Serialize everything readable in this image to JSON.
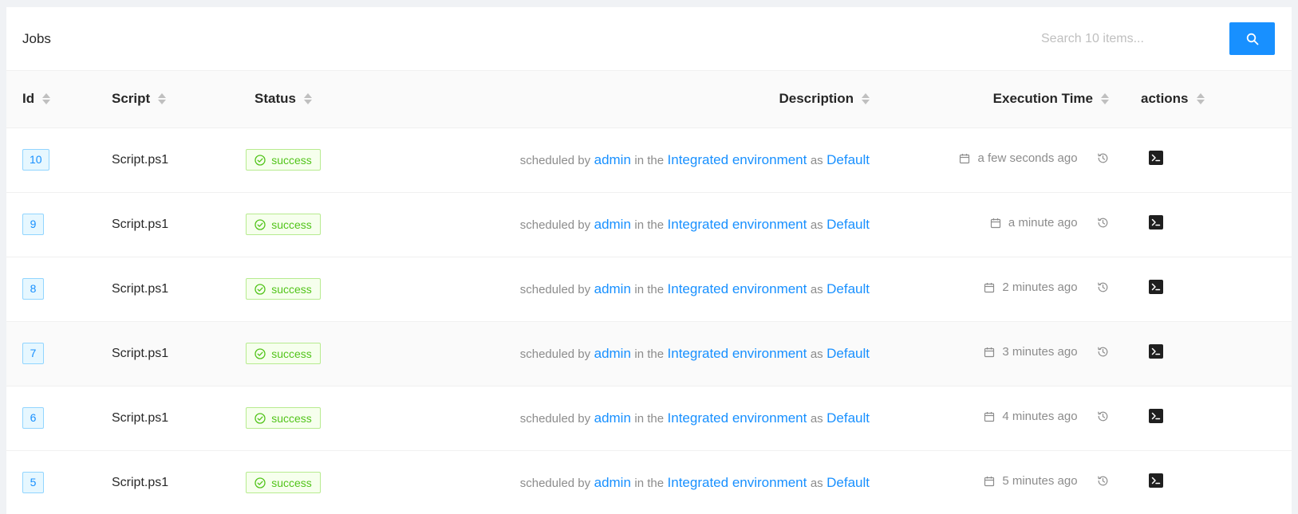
{
  "header": {
    "title": "Jobs",
    "search_placeholder": "Search 10 items...",
    "search_icon": "search-icon"
  },
  "columns": {
    "id": "Id",
    "script": "Script",
    "status": "Status",
    "description": "Description",
    "execution_time": "Execution Time",
    "actions": "actions"
  },
  "colors": {
    "accent": "#1890ff",
    "success": "#52c41a"
  },
  "rows": [
    {
      "id": "10",
      "script": "Script.ps1",
      "status": "success",
      "desc_prefix": "scheduled by",
      "user": "admin",
      "desc_mid": "in the",
      "environment": "Integrated environment",
      "desc_as": "as",
      "credential": "Default",
      "time": "a few seconds ago"
    },
    {
      "id": "9",
      "script": "Script.ps1",
      "status": "success",
      "desc_prefix": "scheduled by",
      "user": "admin",
      "desc_mid": "in the",
      "environment": "Integrated environment",
      "desc_as": "as",
      "credential": "Default",
      "time": "a minute ago"
    },
    {
      "id": "8",
      "script": "Script.ps1",
      "status": "success",
      "desc_prefix": "scheduled by",
      "user": "admin",
      "desc_mid": "in the",
      "environment": "Integrated environment",
      "desc_as": "as",
      "credential": "Default",
      "time": "2 minutes ago"
    },
    {
      "id": "7",
      "script": "Script.ps1",
      "status": "success",
      "desc_prefix": "scheduled by",
      "user": "admin",
      "desc_mid": "in the",
      "environment": "Integrated environment",
      "desc_as": "as",
      "credential": "Default",
      "time": "3 minutes ago"
    },
    {
      "id": "6",
      "script": "Script.ps1",
      "status": "success",
      "desc_prefix": "scheduled by",
      "user": "admin",
      "desc_mid": "in the",
      "environment": "Integrated environment",
      "desc_as": "as",
      "credential": "Default",
      "time": "4 minutes ago"
    },
    {
      "id": "5",
      "script": "Script.ps1",
      "status": "success",
      "desc_prefix": "scheduled by",
      "user": "admin",
      "desc_mid": "in the",
      "environment": "Integrated environment",
      "desc_as": "as",
      "credential": "Default",
      "time": "5 minutes ago"
    }
  ]
}
